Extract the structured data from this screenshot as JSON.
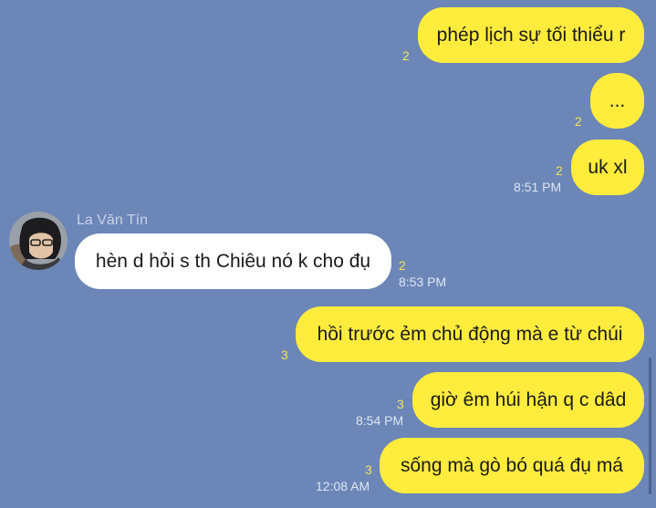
{
  "sender": {
    "name": "La Văn Tín",
    "avatar_icon": "user-avatar-photo"
  },
  "messages": [
    {
      "id": 1,
      "direction": "out",
      "text": "phép lịch sự tối thiểu r",
      "count": "2",
      "time": ""
    },
    {
      "id": 2,
      "direction": "out",
      "text": "...",
      "count": "2",
      "time": ""
    },
    {
      "id": 3,
      "direction": "out",
      "text": "uk xl",
      "count": "2",
      "time": "8:51 PM"
    },
    {
      "id": 4,
      "direction": "in",
      "text": "hèn d hỏi s th Chiêu nó k cho đụ",
      "count": "2",
      "time": "8:53 PM"
    },
    {
      "id": 5,
      "direction": "out",
      "text": "hồi trước ẻm chủ động mà e từ chúi",
      "count": "3",
      "time": ""
    },
    {
      "id": 6,
      "direction": "out",
      "text": "giờ êm húi hận q c dâd",
      "count": "3",
      "time": "8:54 PM"
    },
    {
      "id": 7,
      "direction": "out",
      "text": "sống mà gò bó quá đụ má",
      "count": "3",
      "time": "12:08 AM"
    }
  ],
  "colors": {
    "background": "#6b86b7",
    "outgoing_bubble": "#ffec3d",
    "incoming_bubble": "#ffffff",
    "read_count": "#f7e35a",
    "timestamp": "#dfe6f2"
  }
}
